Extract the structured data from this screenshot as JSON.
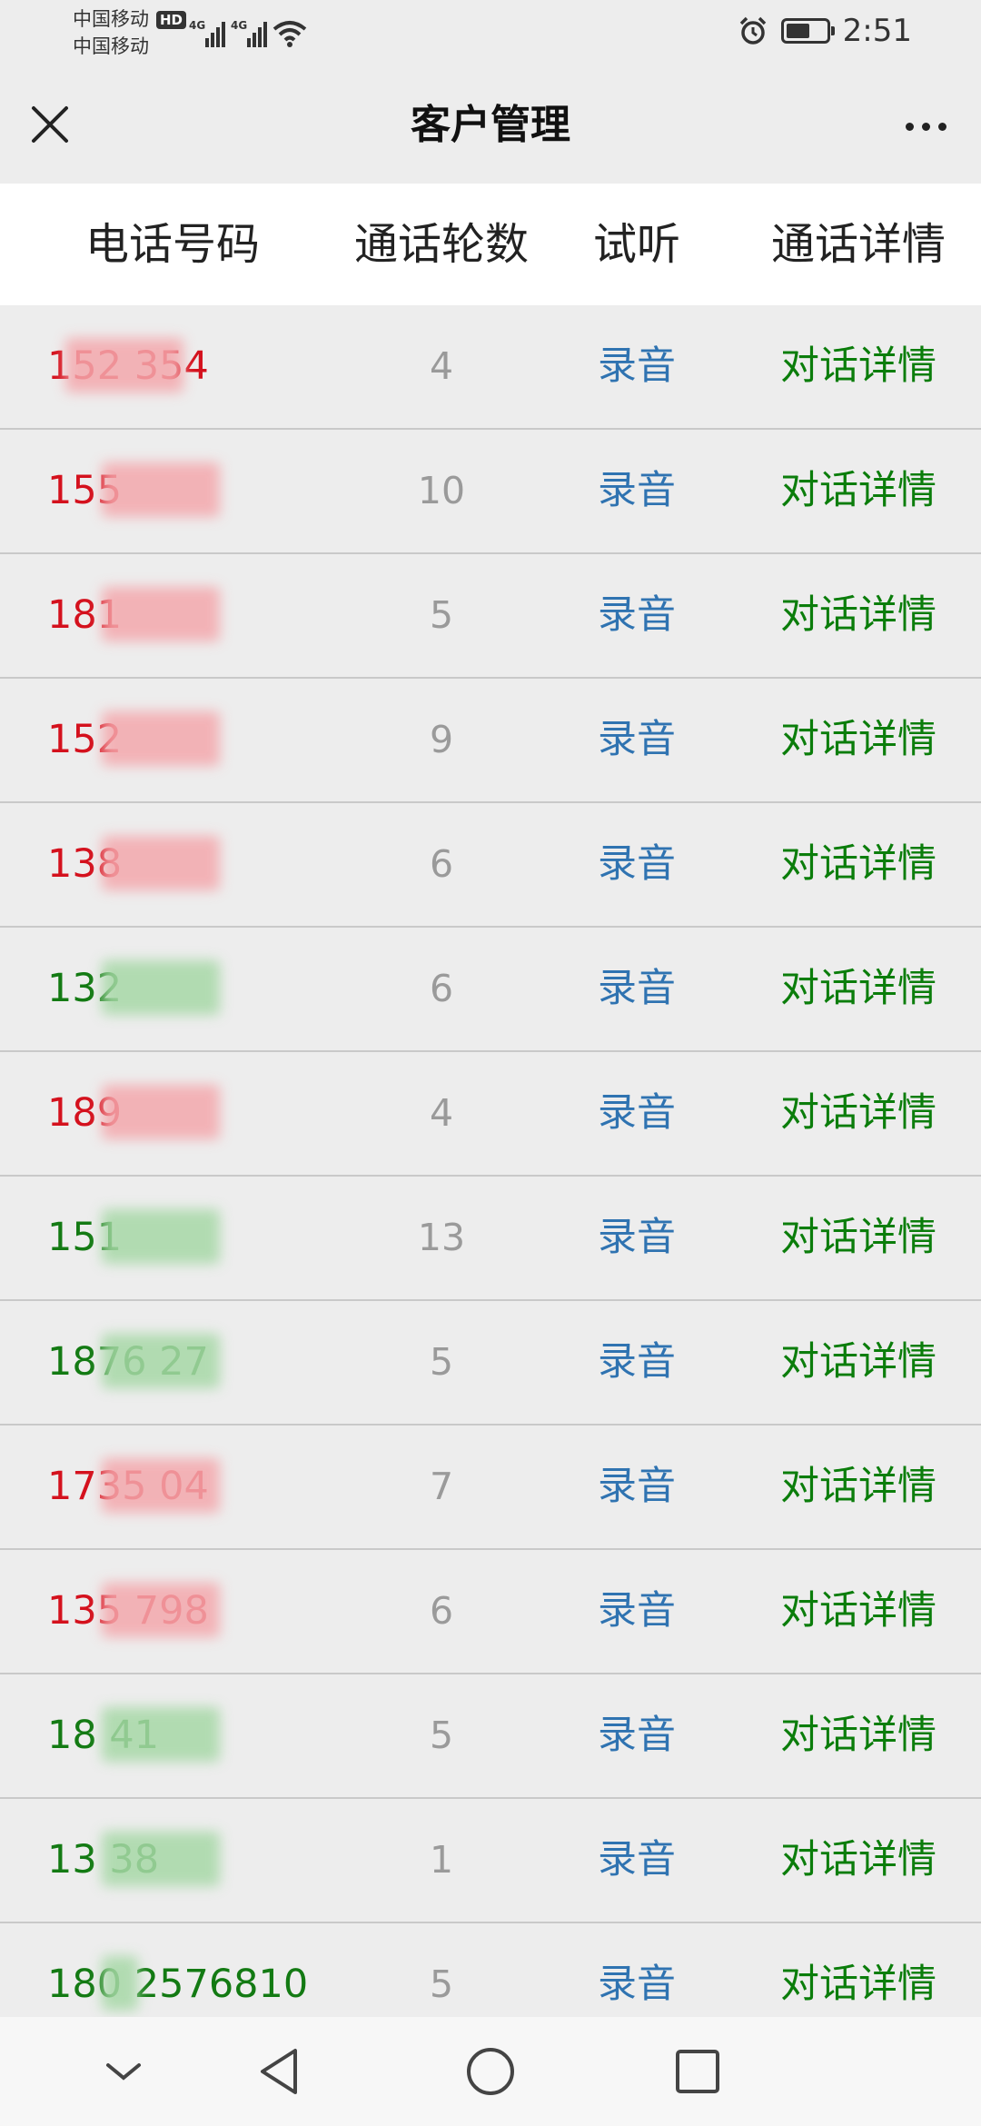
{
  "status_bar": {
    "carrier_1": "中国移动",
    "carrier_2": "中国移动",
    "hd_badge": "HD",
    "network_1": "4G",
    "network_2": "4G",
    "time": "2:51",
    "battery_level": 0.6,
    "icons": [
      "signal-icon",
      "wifi-icon",
      "alarm-icon",
      "battery-icon"
    ]
  },
  "title_bar": {
    "title": "客户管理",
    "close_icon": "close-icon",
    "more_icon": "more-icon"
  },
  "table": {
    "headers": {
      "phone": "电话号码",
      "rounds": "通话轮数",
      "listen": "试听",
      "details": "通话详情"
    },
    "rows": [
      {
        "phone": "152    354",
        "status": "red",
        "rounds": "4",
        "audio": "录音",
        "detail": "对话详情"
      },
      {
        "phone": "155",
        "status": "red",
        "rounds": "10",
        "audio": "录音",
        "detail": "对话详情"
      },
      {
        "phone": "181",
        "status": "red",
        "rounds": "5",
        "audio": "录音",
        "detail": "对话详情"
      },
      {
        "phone": "152",
        "status": "red",
        "rounds": "9",
        "audio": "录音",
        "detail": "对话详情"
      },
      {
        "phone": "138",
        "status": "red",
        "rounds": "6",
        "audio": "录音",
        "detail": "对话详情"
      },
      {
        "phone": "132",
        "status": "green",
        "rounds": "6",
        "audio": "录音",
        "detail": "对话详情"
      },
      {
        "phone": "189",
        "status": "red",
        "rounds": "4",
        "audio": "录音",
        "detail": "对话详情"
      },
      {
        "phone": "151",
        "status": "green",
        "rounds": "13",
        "audio": "录音",
        "detail": "对话详情"
      },
      {
        "phone": "1876     27",
        "status": "green",
        "rounds": "5",
        "audio": "录音",
        "detail": "对话详情"
      },
      {
        "phone": "1735     04",
        "status": "red",
        "rounds": "7",
        "audio": "录音",
        "detail": "对话详情"
      },
      {
        "phone": "135      798",
        "status": "red",
        "rounds": "6",
        "audio": "录音",
        "detail": "对话详情"
      },
      {
        "phone": "18       41",
        "status": "green",
        "rounds": "5",
        "audio": "录音",
        "detail": "对话详情"
      },
      {
        "phone": "13      38",
        "status": "green",
        "rounds": "1",
        "audio": "录音",
        "detail": "对话详情"
      },
      {
        "phone": "180 2576810",
        "status": "green",
        "rounds": "5",
        "audio": "录音",
        "detail": "对话详情"
      }
    ]
  },
  "nav_bar": {
    "buttons": [
      "chevron-down-icon",
      "back-triangle-icon",
      "home-circle-icon",
      "recents-square-icon"
    ]
  }
}
